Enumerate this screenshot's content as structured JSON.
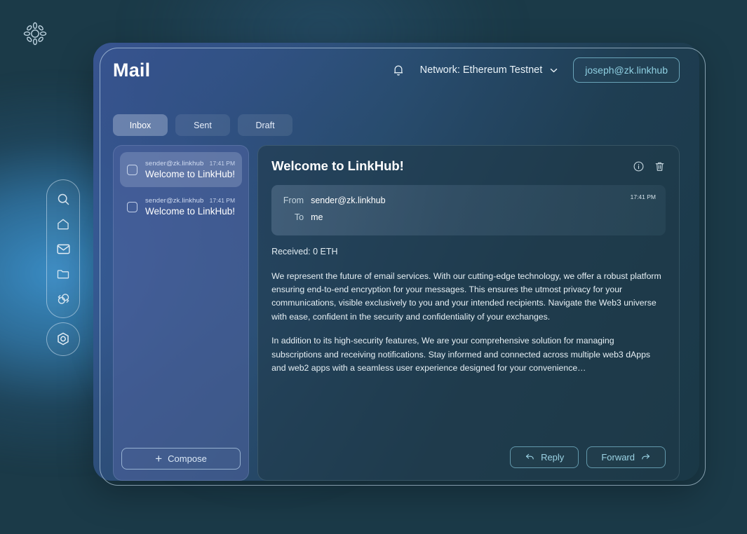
{
  "brand": {
    "logo_icon": "sunburst-logo-icon"
  },
  "sidebar": {
    "items": [
      {
        "icon": "search-icon",
        "name": "search"
      },
      {
        "icon": "home-icon",
        "name": "home"
      },
      {
        "icon": "envelope-icon",
        "name": "mail"
      },
      {
        "icon": "folder-icon",
        "name": "files"
      },
      {
        "icon": "swap-icon",
        "name": "swap"
      }
    ],
    "settings": {
      "icon": "settings-target-icon",
      "name": "settings"
    }
  },
  "header": {
    "title": "Mail",
    "bell_icon": "bell-icon",
    "network_label": "Network: Ethereum Testnet",
    "chevron_icon": "chevron-down-icon",
    "account": "joseph@zk.linkhub"
  },
  "tabs": [
    {
      "label": "Inbox",
      "active": true
    },
    {
      "label": "Sent",
      "active": false
    },
    {
      "label": "Draft",
      "active": false
    }
  ],
  "mail_list": {
    "items": [
      {
        "sender": "sender@zk.linkhub",
        "time": "17:41 PM",
        "subject": "Welcome to LinkHub!",
        "selected": true
      },
      {
        "sender": "sender@zk.linkhub",
        "time": "17:41 PM",
        "subject": "Welcome to LinkHub!",
        "selected": false
      }
    ],
    "compose_label": "Compose",
    "compose_plus": "+"
  },
  "detail": {
    "subject": "Welcome to LinkHub!",
    "info_icon": "info-circle-icon",
    "delete_icon": "trash-icon",
    "from_label": "From",
    "from_value": "sender@zk.linkhub",
    "to_label": "To",
    "to_value": "me",
    "time": "17:41 PM",
    "received": "Received: 0 ETH",
    "paragraph_1": "We represent the future of email services. With our cutting-edge technology, we offer a robust platform ensuring end-to-end encryption for your messages. This ensures the utmost privacy for your communications, visible exclusively to you and your intended recipients. Navigate the Web3 universe with ease, confident in the security and confidentiality of your exchanges.",
    "paragraph_2": "In addition to its high-security features, We are your comprehensive solution for managing subscriptions and receiving notifications. Stay informed and connected across multiple web3 dApps and web2 apps with a seamless user experience designed for your convenience…",
    "reply_label": "Reply",
    "forward_label": "Forward",
    "reply_icon": "arrow-reply-icon",
    "forward_icon": "arrow-forward-icon"
  },
  "colors": {
    "page_bg": "#1b3a48",
    "glow_blue": "#3a8cc4",
    "accent_cyan": "#8fd0e2",
    "list_panel": "#4e629e",
    "detail_panel": "#1f3b4a"
  }
}
